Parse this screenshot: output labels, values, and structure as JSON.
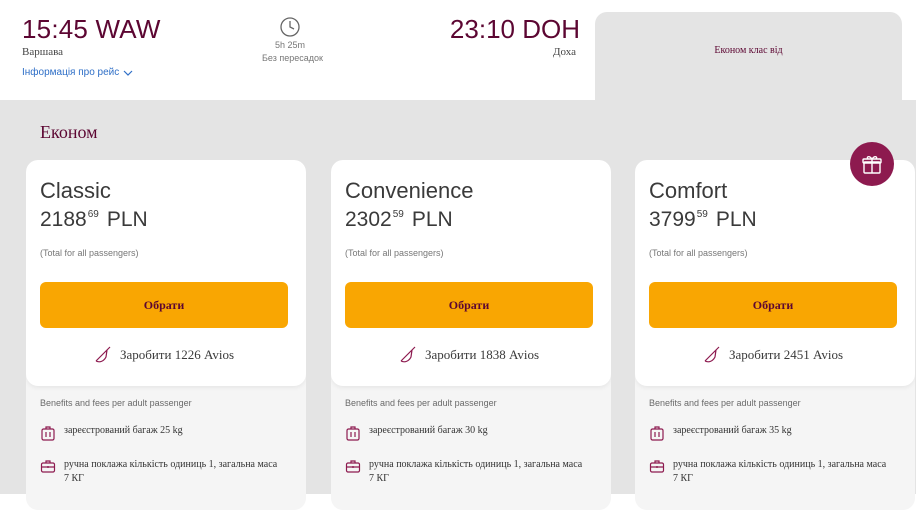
{
  "flight": {
    "departure_time": "15:45 WAW",
    "departure_city": "Варшава",
    "flight_info_link": "Інформація про рейс",
    "duration": "5h 25m",
    "stops": "Без пересадок",
    "arrival_time": "23:10 DOH",
    "arrival_city": "Доха"
  },
  "cabin_tab": {
    "label": "Економ клас від"
  },
  "panel": {
    "title": "Економ"
  },
  "fares": [
    {
      "name": "Classic",
      "price_main": "2188",
      "price_cents": "69",
      "currency": "PLN",
      "total_note": "(Total for all passengers)",
      "select_label": "Обрати",
      "avios": "Заробити 1226 Avios",
      "benefits_heading": "Benefits and fees per adult passenger",
      "checked_bag": "зареєстрований багаж 25 kg",
      "carry_on": "ручна поклажа кількість одиниць 1, загальна маса 7 КГ"
    },
    {
      "name": "Convenience",
      "price_main": "2302",
      "price_cents": "59",
      "currency": "PLN",
      "total_note": "(Total for all passengers)",
      "select_label": "Обрати",
      "avios": "Заробити 1838 Avios",
      "benefits_heading": "Benefits and fees per adult passenger",
      "checked_bag": "зареєстрований багаж 30 kg",
      "carry_on": "ручна поклажа кількість одиниць 1, загальна маса 7 КГ"
    },
    {
      "name": "Comfort",
      "price_main": "3799",
      "price_cents": "59",
      "currency": "PLN",
      "total_note": "(Total for all passengers)",
      "select_label": "Обрати",
      "avios": "Заробити 2451 Avios",
      "benefits_heading": "Benefits and fees per adult passenger",
      "checked_bag": "зареєстрований багаж 35 kg",
      "carry_on": "ручна поклажа кількість одиниць 1, загальна маса 7 КГ"
    }
  ],
  "icons": {
    "clock": "clock-icon",
    "chevron": "chevron-down-icon",
    "avios": "avios-tag-icon",
    "bag": "checked-bag-icon",
    "carry": "carry-on-bag-icon",
    "gift": "gift-icon"
  },
  "colors": {
    "brand": "#5c0632",
    "accent": "#f9a602",
    "badge": "#8d1a4f",
    "panel": "#e4e4e4"
  }
}
